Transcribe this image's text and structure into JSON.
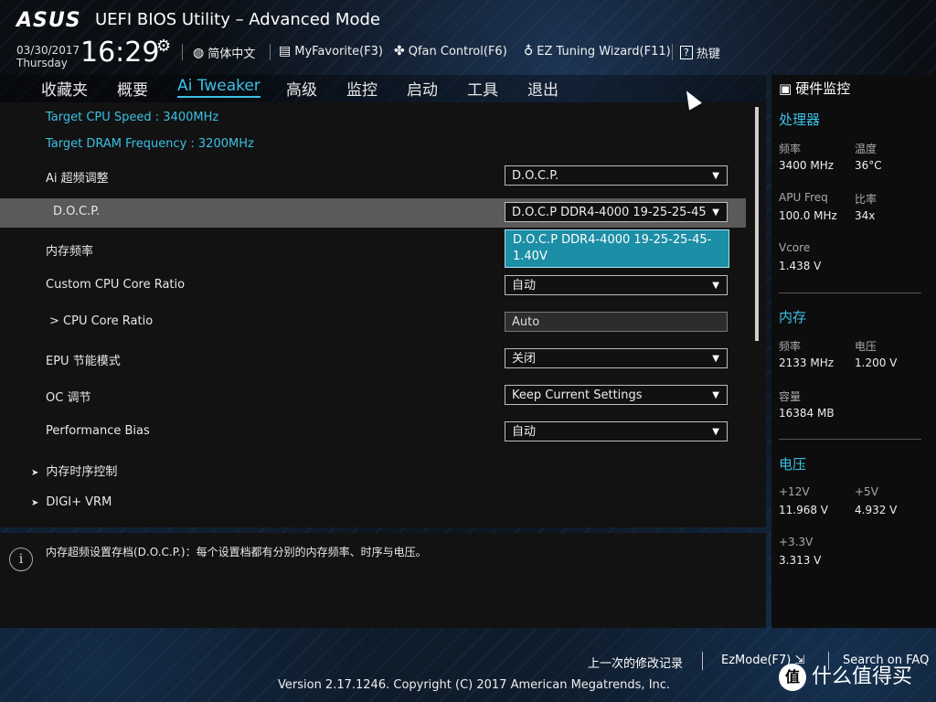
{
  "header": {
    "logo": "ASUS",
    "title": "UEFI BIOS Utility – Advanced Mode",
    "date": "03/30/2017",
    "day": "Thursday",
    "time": "16:29",
    "tools": [
      {
        "icon": "globe-icon",
        "label": "简体中文"
      },
      {
        "icon": "favorite-icon",
        "label": "MyFavorite(F3)"
      },
      {
        "icon": "fan-icon",
        "label": "Qfan Control(F6)"
      },
      {
        "icon": "bulb-icon",
        "label": "EZ Tuning Wizard(F11)"
      },
      {
        "icon": "help-icon",
        "label": "热键"
      }
    ]
  },
  "nav": {
    "tabs": [
      "收藏夹",
      "概要",
      "Ai Tweaker",
      "高级",
      "监控",
      "启动",
      "工具",
      "退出"
    ],
    "active": "Ai Tweaker"
  },
  "main": {
    "info": [
      "Target CPU Speed : 3400MHz",
      "Target DRAM Frequency : 3200MHz"
    ],
    "rows": [
      {
        "label": "Ai 超频调整",
        "value": "D.O.C.P."
      },
      {
        "label": "D.O.C.P.",
        "value": "D.O.C.P DDR4-4000 19-25-25-45"
      },
      {
        "label": "内存频率",
        "value": ""
      },
      {
        "label": "Custom CPU Core Ratio",
        "value": "自动"
      },
      {
        "label": "> CPU Core Ratio",
        "value": "Auto"
      },
      {
        "label": "EPU 节能模式",
        "value": "关闭"
      },
      {
        "label": "OC 调节",
        "value": "Keep Current Settings"
      },
      {
        "label": "Performance Bias",
        "value": "自动"
      }
    ],
    "popup_option": "D.O.C.P DDR4-4000 19-25-25-45-1.40V",
    "submenus": [
      "内存时序控制",
      "DIGI+ VRM"
    ]
  },
  "help": {
    "text": "内存超频设置存档(D.O.C.P.)：每个设置档都有分别的内存频率、时序与电压。"
  },
  "hw": {
    "title": "硬件监控",
    "cpu": {
      "title": "处理器",
      "freq_label": "频率",
      "freq": "3400 MHz",
      "temp_label": "温度",
      "temp": "36°C",
      "apu_label": "APU Freq",
      "apu": "100.0 MHz",
      "ratio_label": "比率",
      "ratio": "34x",
      "vcore_label": "Vcore",
      "vcore": "1.438 V"
    },
    "mem": {
      "title": "内存",
      "freq_label": "频率",
      "freq": "2133 MHz",
      "volt_label": "电压",
      "volt": "1.200 V",
      "cap_label": "容量",
      "cap": "16384 MB"
    },
    "volt": {
      "title": "电压",
      "v12_label": "+12V",
      "v12": "11.968 V",
      "v5_label": "+5V",
      "v5": "4.932 V",
      "v33_label": "+3.3V",
      "v33": "3.313 V"
    }
  },
  "footer": {
    "last_changes": "上一次的修改记录",
    "ezmode": "EzMode(F7)",
    "faq": "Search on FAQ",
    "version": "Version 2.17.1246. Copyright (C) 2017 American Megatrends, Inc.",
    "watermark": "什么值得买",
    "watermark_badge": "值"
  },
  "colors": {
    "accent": "#3cc0e4",
    "popup": "#1c8ea6",
    "highlight_row": "#5a5a5a"
  }
}
